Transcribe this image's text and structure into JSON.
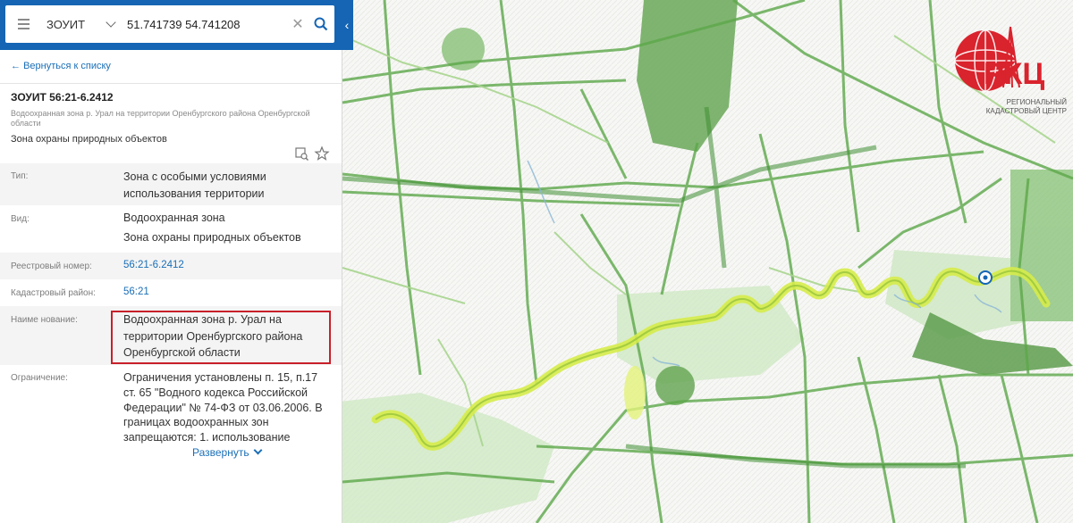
{
  "search": {
    "layer_select": "ЗОУИТ",
    "query": "51.741739 54.741208"
  },
  "panel": {
    "back_link": "Вернуться к списку",
    "object_title": "ЗОУИТ 56:21-6.2412",
    "object_subtitle": "Водоохранная зона р. Урал на территории Оренбургского района Оренбургской области",
    "object_category": "Зона охраны природных объектов",
    "fields": [
      {
        "label": "Тип:",
        "value_lines": [
          "Зона с особыми условиями",
          "использования территории"
        ]
      },
      {
        "label": "Вид:",
        "value_lines": [
          "Водоохранная зона",
          "Зона охраны природных объектов"
        ]
      },
      {
        "label": "Реестровый номер:",
        "value_lines": [
          "56:21-6.2412"
        ]
      },
      {
        "label": "Кадастровый район:",
        "value_lines": [
          "56:21"
        ]
      },
      {
        "label": "Наиме нование:",
        "value_lines": [
          "Водоохранная зона р. Урал на",
          "территории Оренбургского района",
          "Оренбургской области"
        ]
      },
      {
        "label": "Ограничение:",
        "value_lines": [
          "Ограничения установлены п. 15, п.17",
          "ст. 65 \"Водного кодекса Российской",
          "Федерации\" № 74-ФЗ от 03.06.2006. В",
          "границах водоохранных зон",
          "запрещаются: 1. использование"
        ]
      }
    ],
    "expand_label": "Развернуть"
  },
  "logo": {
    "abbr": "РКЦ",
    "line1": "РЕГИОНАЛЬНЫЙ",
    "line2": "КАДАСТРОВЫЙ ЦЕНТР"
  },
  "colors": {
    "topbar": "#1565b4",
    "link": "#1a6fb7",
    "highlight_border": "#c8202a",
    "zone_green": "#5aa14a",
    "river_yellow": "#d6ec4a"
  },
  "icons": [
    "menu-icon",
    "chevron-down-icon",
    "clear-icon",
    "search-icon",
    "collapse-icon",
    "arrow-left-icon",
    "layers-search-icon",
    "star-icon",
    "location-marker-icon"
  ]
}
